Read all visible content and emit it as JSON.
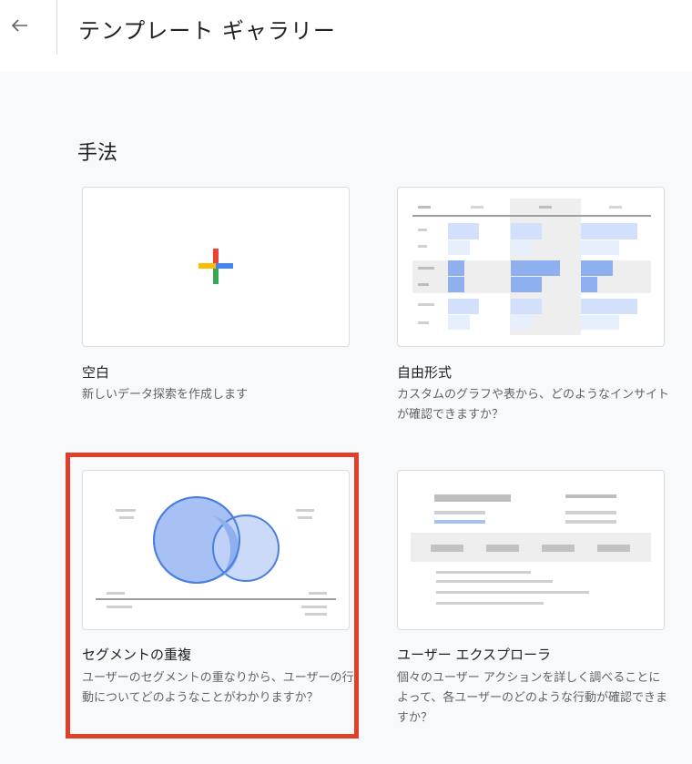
{
  "header": {
    "title": "テンプレート ギャラリー",
    "back_icon": "arrow-back-icon"
  },
  "section": {
    "title": "手法"
  },
  "cards": [
    {
      "title": "空白",
      "description": "新しいデータ探索を作成します",
      "thumbnail": "plus-icon"
    },
    {
      "title": "自由形式",
      "description": "カスタムのグラフや表から、どのようなインサイトが確認できますか？",
      "thumbnail": "table-thumbnail"
    },
    {
      "title": "セグメントの重複",
      "description": "ユーザーのセグメントの重なりから、ユーザーの行動についてどのようなことがわかりますか？",
      "thumbnail": "venn-thumbnail",
      "selected": true
    },
    {
      "title": "ユーザー エクスプローラ",
      "description": "個々のユーザー アクションを詳しく調べることによって、各ユーザーのどのような行動が確認できますか？",
      "thumbnail": "list-thumbnail"
    }
  ],
  "colors": {
    "highlight": "#e0402a",
    "venn_fill": "#8ab0f0",
    "venn_stroke": "#4a7fe0",
    "bar_blue": "#a4c0f4"
  }
}
